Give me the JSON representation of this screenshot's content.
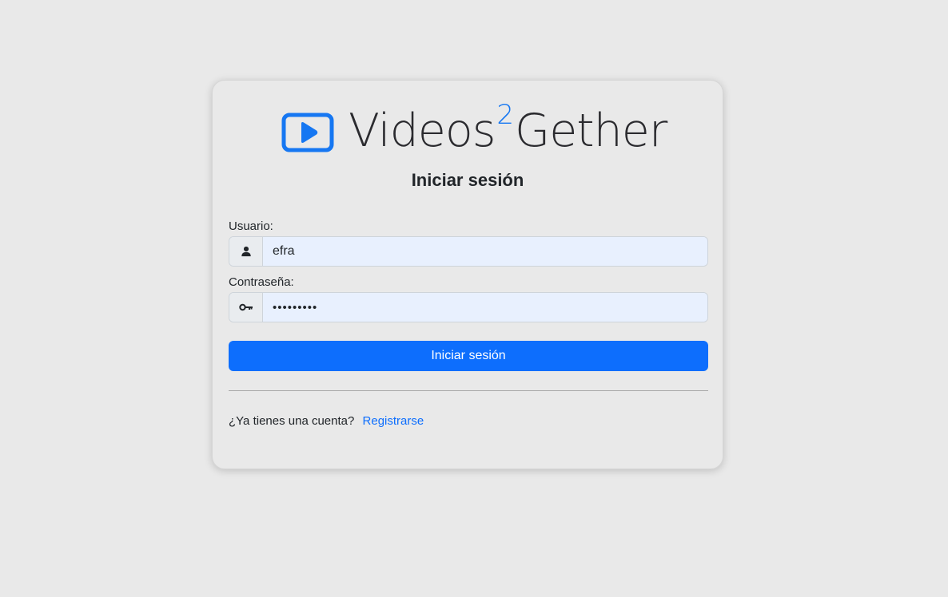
{
  "brand": {
    "name_part1": "Videos",
    "superscript": "2",
    "name_part2": "Gether",
    "accent_color": "#1677f2",
    "icon": "play-icon"
  },
  "form": {
    "title": "Iniciar sesión",
    "username_label": "Usuario:",
    "username_icon": "user-icon",
    "username_value": "efra",
    "password_label": "Contraseña:",
    "password_icon": "key-icon",
    "password_value": "•••••••••",
    "submit_label": "Iniciar sesión",
    "button_color": "#0d6efd"
  },
  "footer": {
    "prompt": "¿Ya tienes una cuenta?",
    "register_link": "Registrarse"
  }
}
